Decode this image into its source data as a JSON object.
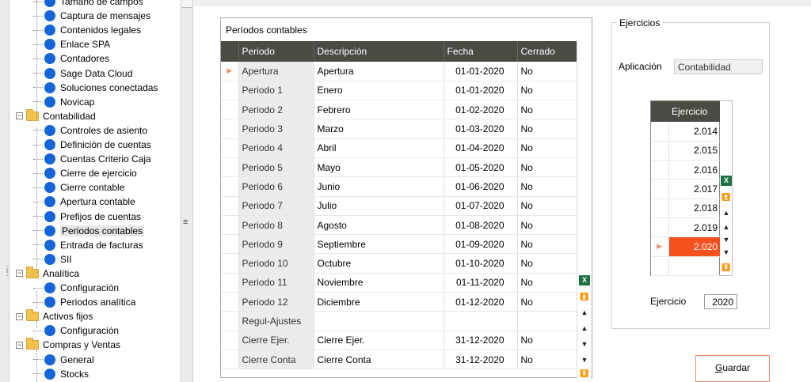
{
  "tree": {
    "items": [
      {
        "type": "leaf",
        "label": "Tamaño de campos",
        "level": 2
      },
      {
        "type": "leaf",
        "label": "Captura de mensajes",
        "level": 2
      },
      {
        "type": "leaf",
        "label": "Contenidos legales",
        "level": 2
      },
      {
        "type": "leaf",
        "label": "Enlace SPA",
        "level": 2
      },
      {
        "type": "leaf",
        "label": "Contadores",
        "level": 2
      },
      {
        "type": "leaf",
        "label": "Sage Data Cloud",
        "level": 2
      },
      {
        "type": "leaf",
        "label": "Soluciones conectadas",
        "level": 2
      },
      {
        "type": "leaf",
        "label": "Novicap",
        "level": 2
      },
      {
        "type": "folder",
        "label": "Contabilidad",
        "expanded": true
      },
      {
        "type": "leaf",
        "label": "Controles de asiento",
        "level": 2
      },
      {
        "type": "leaf",
        "label": "Definición de cuentas",
        "level": 2
      },
      {
        "type": "leaf",
        "label": "Cuentas Criterio Caja",
        "level": 2
      },
      {
        "type": "leaf",
        "label": "Cierre de ejercicio",
        "level": 2
      },
      {
        "type": "leaf",
        "label": "Cierre contable",
        "level": 2
      },
      {
        "type": "leaf",
        "label": "Apertura contable",
        "level": 2
      },
      {
        "type": "leaf",
        "label": "Prefijos de cuentas",
        "level": 2
      },
      {
        "type": "leaf",
        "label": "Periodos contables",
        "level": 2,
        "selected": true
      },
      {
        "type": "leaf",
        "label": "Entrada de facturas",
        "level": 2
      },
      {
        "type": "leaf",
        "label": "SII",
        "level": 2
      },
      {
        "type": "folder",
        "label": "Analítica",
        "expanded": true
      },
      {
        "type": "leaf",
        "label": "Configuración",
        "level": 2
      },
      {
        "type": "leaf",
        "label": "Periodos analítica",
        "level": 2
      },
      {
        "type": "folder",
        "label": "Activos fijos",
        "expanded": true
      },
      {
        "type": "leaf",
        "label": "Configuración",
        "level": 2
      },
      {
        "type": "folder",
        "label": "Compras y Ventas",
        "expanded": true
      },
      {
        "type": "leaf",
        "label": "General",
        "level": 2
      },
      {
        "type": "leaf",
        "label": "Stocks",
        "level": 2
      }
    ],
    "expand_symbol": "−",
    "splitter_symbol": "≡"
  },
  "periodos": {
    "title": "Períodos contables",
    "columns": [
      "Periodo",
      "Descripción",
      "Fecha",
      "Cerrado"
    ],
    "rows": [
      {
        "periodo": "Apertura",
        "descripcion": "Apertura",
        "fecha": "01-01-2020",
        "cerrado": "No",
        "current": true
      },
      {
        "periodo": "Periodo 1",
        "descripcion": "Enero",
        "fecha": "01-01-2020",
        "cerrado": "No"
      },
      {
        "periodo": "Periodo 2",
        "descripcion": "Febrero",
        "fecha": "01-02-2020",
        "cerrado": "No"
      },
      {
        "periodo": "Periodo 3",
        "descripcion": "Marzo",
        "fecha": "01-03-2020",
        "cerrado": "No"
      },
      {
        "periodo": "Periodo 4",
        "descripcion": "Abril",
        "fecha": "01-04-2020",
        "cerrado": "No"
      },
      {
        "periodo": "Periodo 5",
        "descripcion": "Mayo",
        "fecha": "01-05-2020",
        "cerrado": "No"
      },
      {
        "periodo": "Periodo 6",
        "descripcion": "Junio",
        "fecha": "01-06-2020",
        "cerrado": "No"
      },
      {
        "periodo": "Periodo 7",
        "descripcion": "Julio",
        "fecha": "01-07-2020",
        "cerrado": "No"
      },
      {
        "periodo": "Periodo 8",
        "descripcion": "Agosto",
        "fecha": "01-08-2020",
        "cerrado": "No"
      },
      {
        "periodo": "Periodo 9",
        "descripcion": "Septiembre",
        "fecha": "01-09-2020",
        "cerrado": "No"
      },
      {
        "periodo": "Periodo 10",
        "descripcion": "Octubre",
        "fecha": "01-10-2020",
        "cerrado": "No"
      },
      {
        "periodo": "Periodo 11",
        "descripcion": "Noviembre",
        "fecha": "01-11-2020",
        "cerrado": "No"
      },
      {
        "periodo": "Periodo 12",
        "descripcion": "Diciembre",
        "fecha": "01-12-2020",
        "cerrado": "No"
      },
      {
        "periodo": "Regul-Ajustes",
        "descripcion": "",
        "fecha": "",
        "cerrado": ""
      },
      {
        "periodo": "Cierre Ejer.",
        "descripcion": "Cierre Ejer.",
        "fecha": "31-12-2020",
        "cerrado": "No"
      },
      {
        "periodo": "Cierre Conta",
        "descripcion": "Cierre Conta",
        "fecha": "31-12-2020",
        "cerrado": "No"
      }
    ]
  },
  "ejercicios": {
    "title": "Ejercicios",
    "aplicacion_label": "Aplicación",
    "aplicacion_value": "Contabilidad",
    "column": "Ejercicio",
    "years": [
      "2.014",
      "2.015",
      "2.016",
      "2.017",
      "2.018",
      "2.019",
      "2.020"
    ],
    "selected_index": 6,
    "ejercicio_label": "Ejercicio",
    "ejercicio_value": "2020"
  },
  "icons": {
    "excel": "X",
    "first": "⏫",
    "prev_page": "▲",
    "prev": "▲",
    "next": "▼",
    "next_page": "▼",
    "last": "⏬",
    "row_indicator": "▶"
  },
  "buttons": {
    "guardar_access": "G",
    "guardar_rest": "uardar"
  },
  "colors": {
    "header": "#4b4b44",
    "selected": "#f4511e",
    "accent_border": "#f08f6c",
    "tree_dot": "#1565d8"
  }
}
